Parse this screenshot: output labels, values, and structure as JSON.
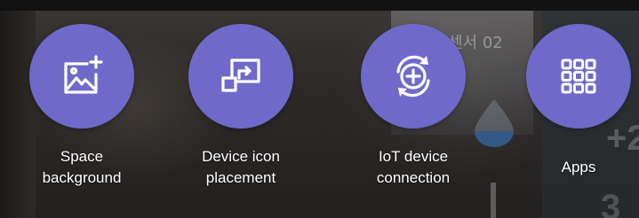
{
  "background": {
    "sensor_text": "센서 02"
  },
  "actions": [
    {
      "label_line1": "Space",
      "label_line2": "background",
      "icon": "add-image-icon"
    },
    {
      "label_line1": "Device icon",
      "label_line2": "placement",
      "icon": "device-placement-icon"
    },
    {
      "label_line1": "IoT device",
      "label_line2": "connection",
      "icon": "add-device-sync-icon"
    },
    {
      "label_line1": "Apps",
      "label_line2": "",
      "icon": "apps-grid-icon"
    }
  ],
  "colors": {
    "accent": "#6f6ac9",
    "label": "#ffffff"
  }
}
